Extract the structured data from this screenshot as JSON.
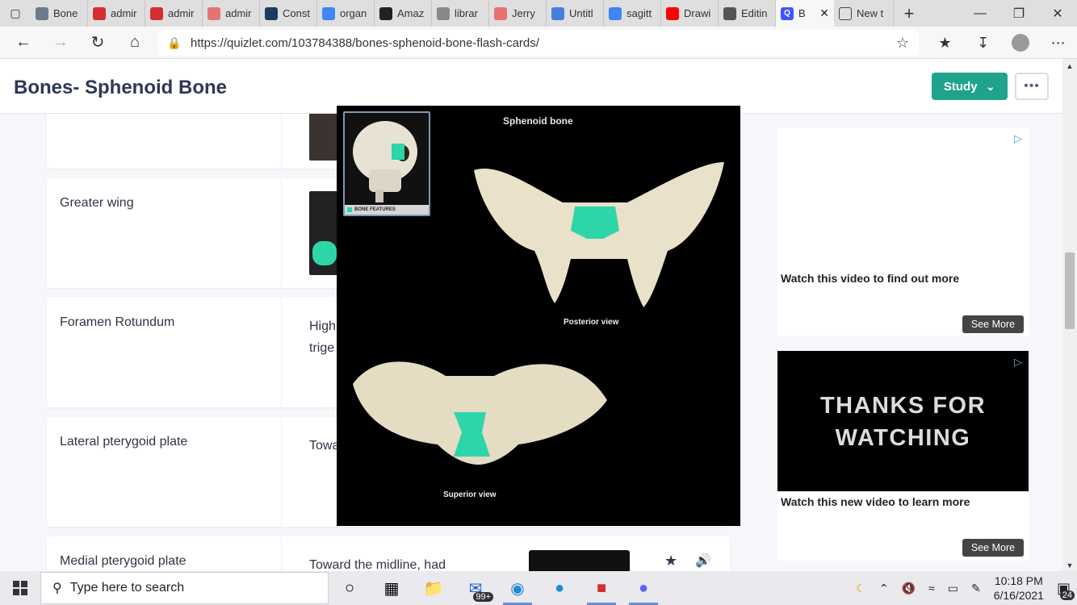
{
  "browser": {
    "tabs": [
      {
        "label": "Bone",
        "favicon_color": "#6c7a8a"
      },
      {
        "label": "admir",
        "favicon_color": "#d32f2f"
      },
      {
        "label": "admir",
        "favicon_color": "#d32f2f"
      },
      {
        "label": "admir",
        "favicon_color": "#e57373"
      },
      {
        "label": "Const",
        "favicon_color": "#1e3a5f"
      },
      {
        "label": "organ",
        "favicon_color": "#4285f4"
      },
      {
        "label": "Amaz",
        "favicon_color": "#222222"
      },
      {
        "label": "librar",
        "favicon_color": "#888888"
      },
      {
        "label": "Jerry",
        "favicon_color": "#e57373"
      },
      {
        "label": "Untitl",
        "favicon_color": "#4a7de0"
      },
      {
        "label": "sagitt",
        "favicon_color": "#4285f4"
      },
      {
        "label": "Drawi",
        "favicon_color": "#ff0000"
      },
      {
        "label": "Editin",
        "favicon_color": "#555555"
      }
    ],
    "active_tab": {
      "label": "B",
      "favicon": "Q",
      "favicon_color": "#4255ff"
    },
    "last_tab": {
      "label": "New t"
    },
    "url": "https://quizlet.com/103784388/bones-sphenoid-bone-flash-cards/"
  },
  "page": {
    "title": "Bones- Sphenoid Bone",
    "study_label": "Study",
    "more_label": "•••",
    "accent": "#1fa38a"
  },
  "cards": [
    {
      "term": "Greater wing",
      "definition": ""
    },
    {
      "term": "Foramen Rotundum",
      "definition": "High\ntrige"
    },
    {
      "term": "Lateral pterygoid plate",
      "definition": "Towa"
    },
    {
      "term": "Medial pterygoid plate",
      "definition": "Toward the midline, had"
    }
  ],
  "overlay": {
    "title": "Sphenoid bone",
    "inset_label": "BONE FEATURES",
    "posterior_label": "Posterior view",
    "superior_label": "Superior view"
  },
  "ads": {
    "ad1_text": "Watch this video to find out more",
    "ad1_button": "See More",
    "ad2_video_text": "THANKS FOR WATCHING",
    "ad2_text": "Watch this new video to learn more",
    "ad2_button": "See More"
  },
  "taskbar": {
    "search_placeholder": "Type here to search",
    "mail_badge": "99+",
    "time": "10:18 PM",
    "date": "6/16/2021",
    "notifications": "24"
  }
}
